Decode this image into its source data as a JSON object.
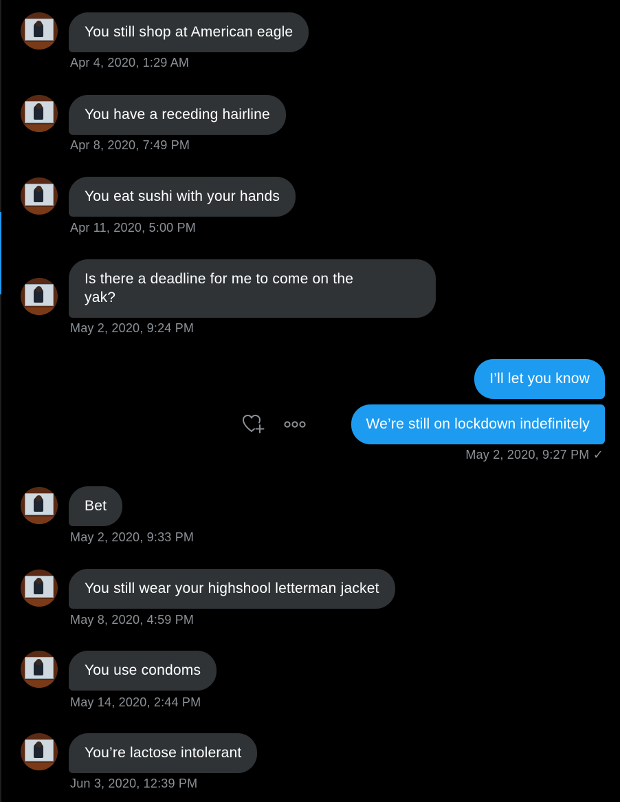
{
  "conversation": {
    "messages": [
      {
        "text": "You still shop at American eagle",
        "time": "Apr 4, 2020, 1:29 AM"
      },
      {
        "text": "You have a receding hairline",
        "time": "Apr 8, 2020, 7:49 PM"
      },
      {
        "text": "You eat sushi with your hands",
        "time": "Apr 11, 2020, 5:00 PM"
      },
      {
        "text": "Is there a deadline for me to come on the",
        "text_line2": "yak?",
        "time": "May 2, 2020, 9:24 PM"
      },
      {
        "text": "I’ll let you know"
      },
      {
        "text": "We’re still on lockdown indefinitely",
        "time": "May 2, 2020, 9:27 PM",
        "status": "✓"
      },
      {
        "text": "Bet",
        "time": "May 2, 2020, 9:33 PM"
      },
      {
        "text": "You still wear your highshool letterman jacket",
        "time": "May 8, 2020, 4:59 PM"
      },
      {
        "text": "You use condoms",
        "time": "May 14, 2020, 2:44 PM"
      },
      {
        "text": "You’re lactose intolerant",
        "time": "Jun 3, 2020, 12:39 PM"
      }
    ]
  },
  "icons": {
    "avatar": "avatar-image",
    "react": "heart-plus-icon",
    "more": "more-dots-icon",
    "sent": "checkmark-icon"
  },
  "colors": {
    "background": "#000000",
    "incoming_bubble": "#2f3336",
    "outgoing_bubble": "#1d9bf0",
    "timestamp": "#8b9196"
  }
}
